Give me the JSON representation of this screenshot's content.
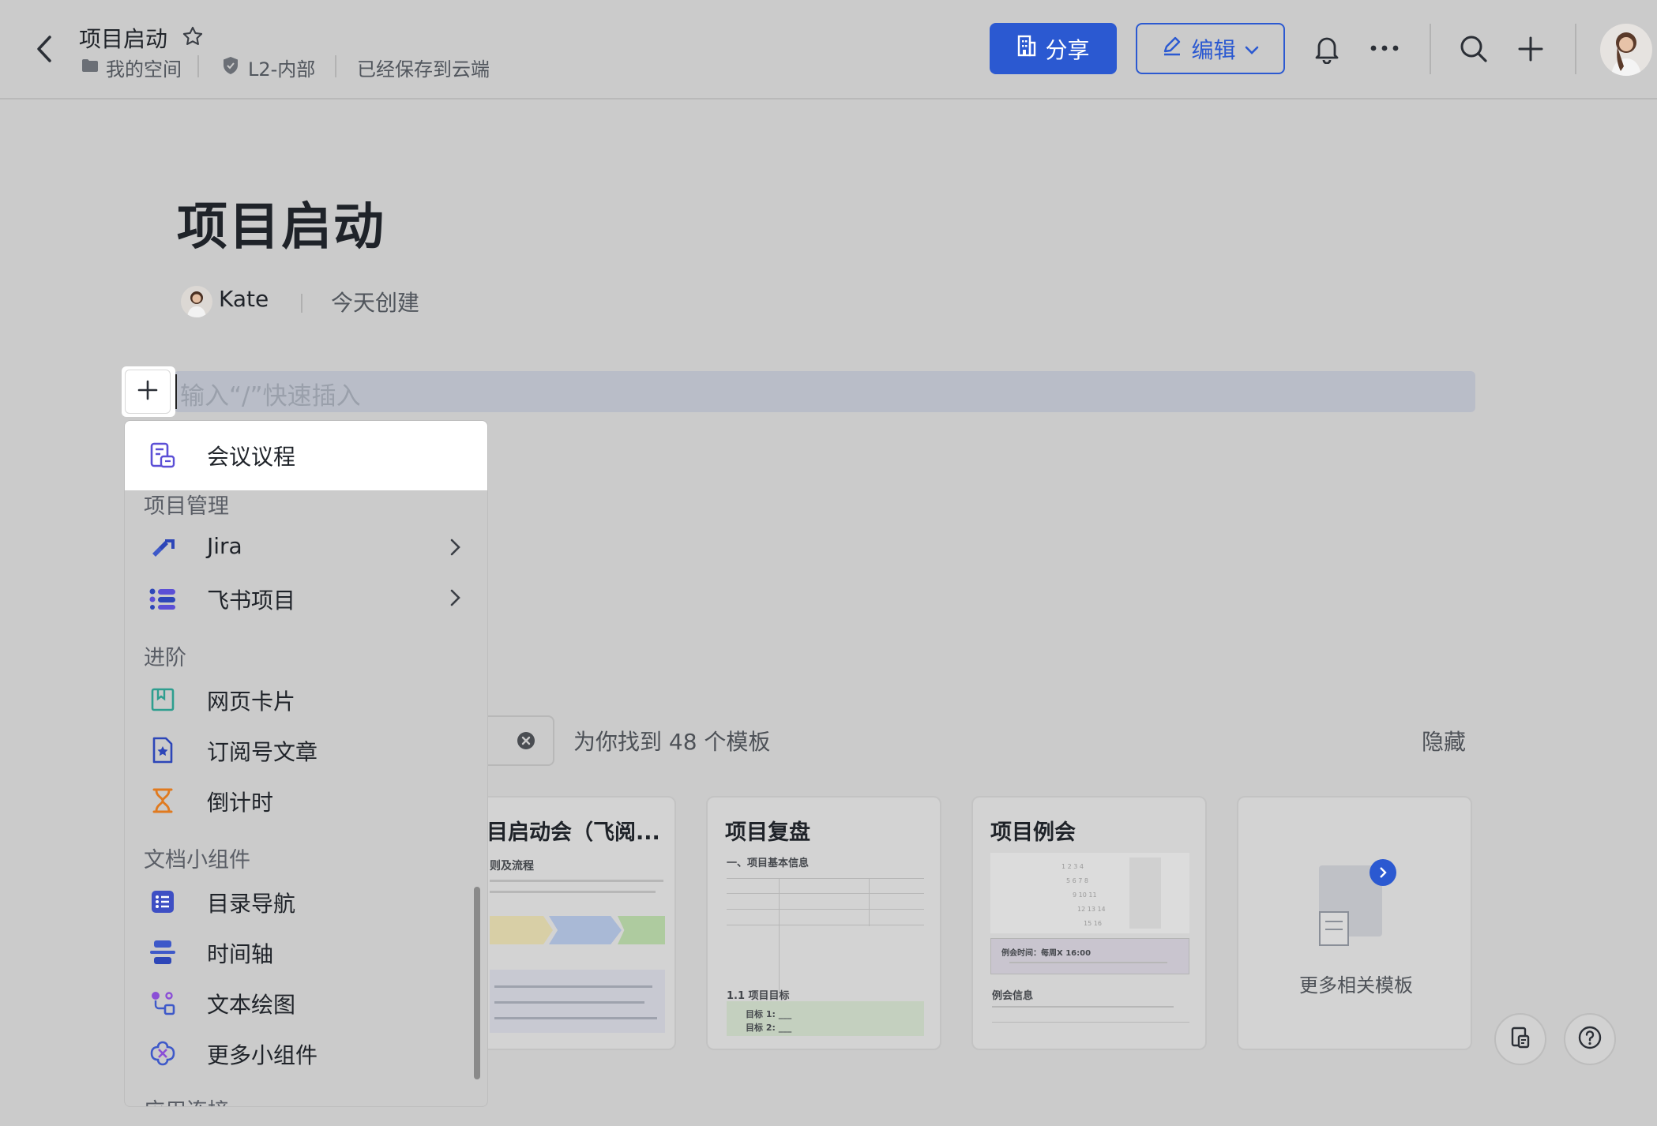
{
  "header": {
    "title": "项目启动",
    "breadcrumb_space": "我的空间",
    "security_label": "L2-内部",
    "save_status": "已经保存到云端",
    "share_label": "分享",
    "edit_label": "编辑",
    "icons": [
      "back-arrow-icon",
      "star-icon",
      "folder-icon",
      "shield-icon",
      "building-icon",
      "pen-icon",
      "chevron-down-icon",
      "bell-icon",
      "more-icon",
      "search-icon",
      "plus-icon",
      "avatar"
    ]
  },
  "document": {
    "title": "项目启动",
    "author": "Kate",
    "created": "今天创建",
    "insert_placeholder": "输入“/”快速插入"
  },
  "templates": {
    "found_text": "为你找到 48 个模板",
    "hide_label": "隐藏",
    "cards": [
      {
        "title": "目启动会（飞阅...",
        "subtitle": "则及流程"
      },
      {
        "title": "项目复盘",
        "subtitle": "一、项目基本信息",
        "section": "1.1 项目目标",
        "goal1": "目标 1: ___",
        "goal2": "目标 2: ___"
      },
      {
        "title": "项目例会",
        "subtitle": "例会信息",
        "meeting_time": "例会时间：每周X 16:00"
      },
      {
        "title": "更多相关模板"
      }
    ]
  },
  "menu": {
    "top_item": "会议议程",
    "sections": [
      {
        "title": "项目管理",
        "items": [
          {
            "label": "Jira",
            "submenu": true
          },
          {
            "label": "飞书项目",
            "submenu": true
          }
        ]
      },
      {
        "title": "进阶",
        "items": [
          {
            "label": "网页卡片"
          },
          {
            "label": "订阅号文章"
          },
          {
            "label": "倒计时"
          }
        ]
      },
      {
        "title": "文档小组件",
        "items": [
          {
            "label": "目录导航"
          },
          {
            "label": "时间轴"
          },
          {
            "label": "文本绘图"
          },
          {
            "label": "更多小组件"
          }
        ]
      }
    ],
    "cut_off_section": "应用连接"
  },
  "colors": {
    "accent": "#2b59d1",
    "icon_purple": "#5b4fd6",
    "icon_teal": "#2e9e8f",
    "icon_orange": "#e07a1f",
    "background_dim": "#cbcbcb"
  }
}
